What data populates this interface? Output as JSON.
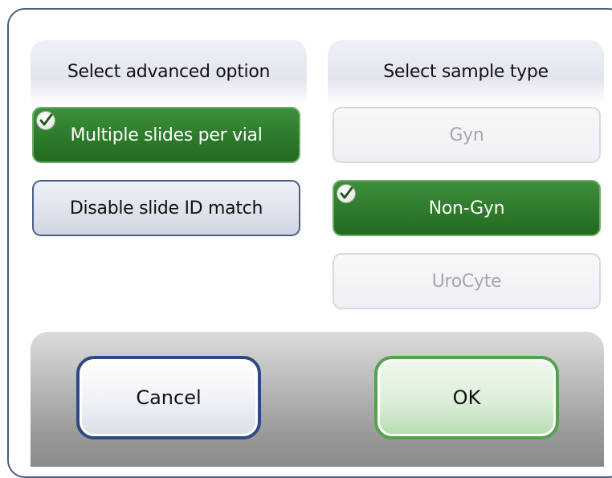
{
  "left_panel": {
    "title": "Select advanced option",
    "options": [
      {
        "label": "Multiple slides per vial",
        "state": "selected"
      },
      {
        "label": "Disable slide ID match",
        "state": "normal"
      }
    ]
  },
  "right_panel": {
    "title": "Select sample type",
    "options": [
      {
        "label": "Gyn",
        "state": "disabled"
      },
      {
        "label": "Non-Gyn",
        "state": "selected"
      },
      {
        "label": "UroCyte",
        "state": "disabled"
      }
    ]
  },
  "buttons": {
    "cancel": "Cancel",
    "ok": "OK"
  },
  "icons": {
    "selected_marker": "check-icon"
  },
  "colors": {
    "selected_green": "#2f7c2c",
    "border_blue": "#2c4b80",
    "ok_border_green": "#54a24e"
  }
}
